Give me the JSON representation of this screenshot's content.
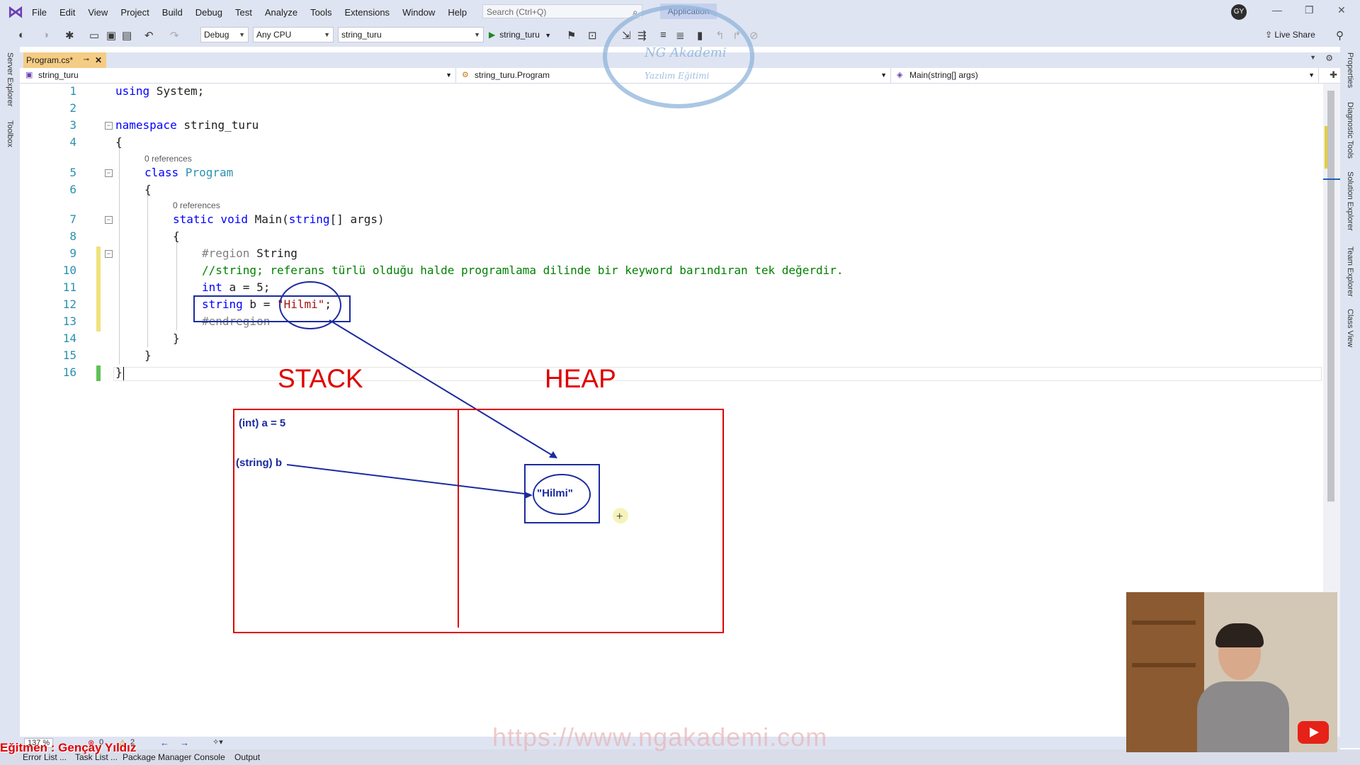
{
  "menu": [
    "File",
    "Edit",
    "View",
    "Project",
    "Build",
    "Debug",
    "Test",
    "Analyze",
    "Tools",
    "Extensions",
    "Window",
    "Help"
  ],
  "search": {
    "placeholder": "Search (Ctrl+Q)"
  },
  "app_badge": "Application",
  "user_initials": "GY",
  "toolbar": {
    "config": "Debug",
    "platform": "Any CPU",
    "project": "string_turu",
    "run_label": "string_turu",
    "live_share": "Live Share"
  },
  "left_strip": {
    "server_explorer": "Server Explorer",
    "toolbox": "Toolbox"
  },
  "right_strip": [
    "Properties",
    "Diagnostic Tools",
    "Solution Explorer",
    "Team Explorer",
    "Class View"
  ],
  "tab": {
    "title": "Program.cs*"
  },
  "navbar": {
    "project": "string_turu",
    "class": "string_turu.Program",
    "member": "Main(string[] args)"
  },
  "code": {
    "line_numbers": [
      "1",
      "2",
      "3",
      "4",
      "5",
      "6",
      "7",
      "8",
      "9",
      "10",
      "11",
      "12",
      "13",
      "14",
      "15",
      "16"
    ],
    "l1_kw": "using",
    "l1_rest": " System;",
    "l3_kw": "namespace",
    "l3_rest": " string_turu",
    "brace_open": "{",
    "brace_close": "}",
    "refs": "0 references",
    "l5_kw": "class",
    "l5_ty": " Program",
    "l7_kw": "static void",
    "l7_rest": " Main(",
    "l7_kw2": "string",
    "l7_rest2": "[] args)",
    "l9_kw": "#region",
    "l9_rest": " String",
    "l10_comment": "//string; referans türlü olduğu halde programlama dilinde bir keyword barındıran tek değerdir.",
    "l11_kw": "int",
    "l11_rest": " a = 5;",
    "l12_kw": "string",
    "l12_rest": " b = ",
    "l12_str": "\"Hilmi\"",
    "l12_end": ";",
    "l13_kw": "#endregion"
  },
  "annotations": {
    "stack": "STACK",
    "heap": "HEAP",
    "stack_item_a": "(int) a = 5",
    "stack_item_b": "(string) b",
    "heap_value": "\"Hilmi\"",
    "ink_color": "#1c2b9f",
    "label_color": "#e00000"
  },
  "watermark_logo": {
    "line1": "NG Akademi",
    "line2": "Yazılım Eğitimi"
  },
  "watermark_url": "https://www.ngakademi.com",
  "zoom": "137 %",
  "errors": "0",
  "warnings": "2",
  "bottom_tabs": [
    "Error List ...",
    "Task List ...",
    "Package Manager Console",
    "Output"
  ],
  "instructor": "Eğitmen : Gençay Yıldız"
}
